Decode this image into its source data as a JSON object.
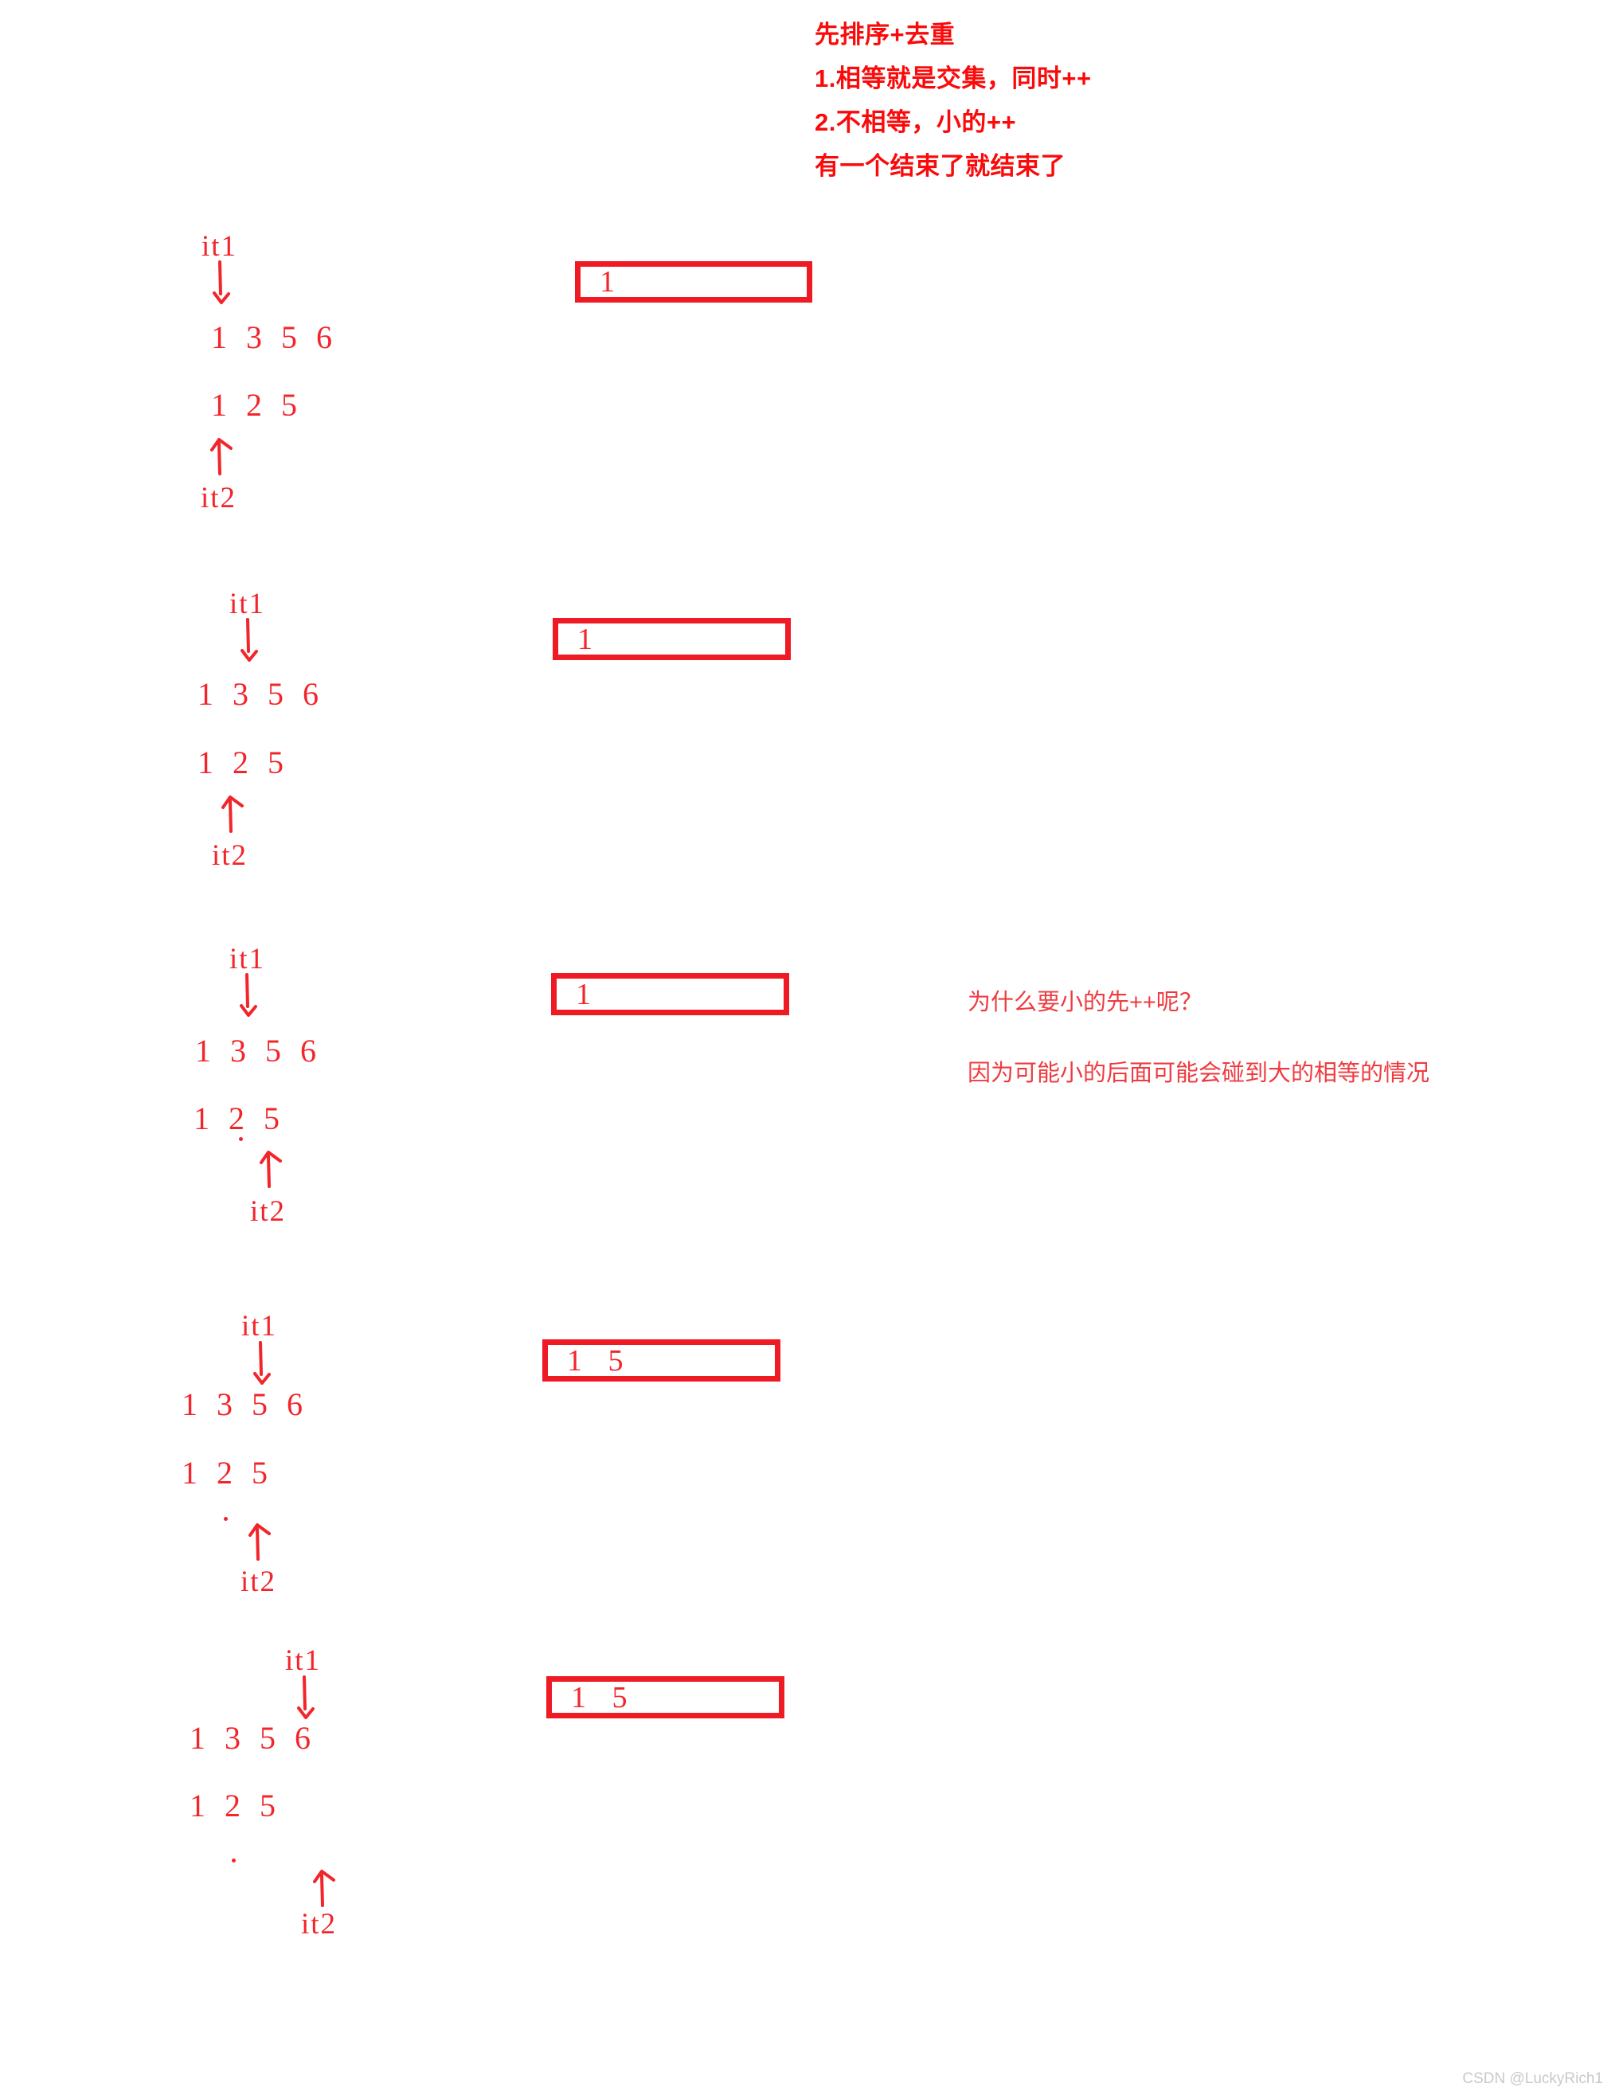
{
  "header_note": {
    "lines": [
      "先排序+去重",
      "1.相等就是交集，同时++",
      "2.不相等，小的++",
      "有一个结束了就结束了"
    ]
  },
  "colors": {
    "ink_red": "#f2252b",
    "box_border_red": "#ee1b24",
    "header_red": "#fa0a0a",
    "note_red": "#ef3b40",
    "watermark_gray": "#c9c9c9",
    "background": "#ffffff"
  },
  "labels": {
    "it1": "it1",
    "it2": "it2"
  },
  "arrays": {
    "top": [
      "1",
      "3",
      "5",
      "6"
    ],
    "bottom": [
      "1",
      "2",
      "5"
    ]
  },
  "steps": [
    {
      "id": "step-1",
      "it1_label": "it1",
      "it1_index": 0,
      "it2_label": "it2",
      "it2_index": 0,
      "top_array": [
        "1",
        "3",
        "5",
        "6"
      ],
      "bottom_array": [
        "1",
        "2",
        "5"
      ],
      "result": "1"
    },
    {
      "id": "step-2",
      "it1_label": "it1",
      "it1_index": 1,
      "it2_label": "it2",
      "it2_index": 1,
      "top_array": [
        "1",
        "3",
        "5",
        "6"
      ],
      "bottom_array": [
        "1",
        "2",
        "5"
      ],
      "result": "1"
    },
    {
      "id": "step-3",
      "it1_label": "it1",
      "it1_index": 1,
      "it2_label": "it2",
      "it2_index": 2,
      "top_array": [
        "1",
        "3",
        "5",
        "6"
      ],
      "bottom_array": [
        "1",
        "2",
        "5"
      ],
      "result": "1"
    },
    {
      "id": "step-4",
      "it1_label": "it1",
      "it1_index": 2,
      "it2_label": "it2",
      "it2_index": 2,
      "top_array": [
        "1",
        "3",
        "5",
        "6"
      ],
      "bottom_array": [
        "1",
        "2",
        "5"
      ],
      "result": "1   5"
    },
    {
      "id": "step-5",
      "it1_label": "it1",
      "it1_index": 3,
      "it2_label": "it2",
      "it2_index": 3,
      "top_array": [
        "1",
        "3",
        "5",
        "6"
      ],
      "bottom_array": [
        "1",
        "2",
        "5"
      ],
      "result": "1   5"
    }
  ],
  "side_notes": {
    "question": "为什么要小的先++呢？",
    "answer": "因为可能小的后面可能会碰到大的相等的情况"
  },
  "watermark": "CSDN @LuckyRich1"
}
